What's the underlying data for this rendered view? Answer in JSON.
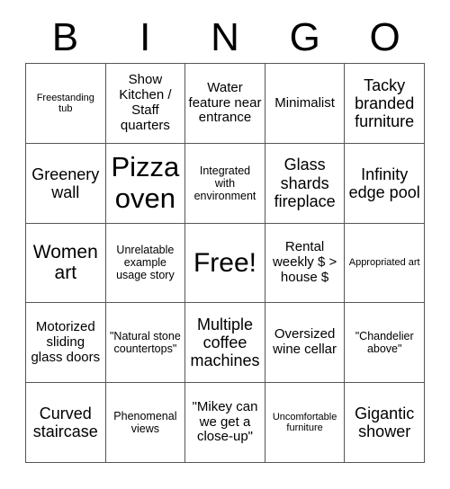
{
  "card": {
    "title": "BINGO",
    "header_letters": [
      "B",
      "I",
      "N",
      "G",
      "O"
    ],
    "grid": {
      "rows": 5,
      "columns": 5
    },
    "cells": [
      {
        "text": "Freestanding tub",
        "size": "xs"
      },
      {
        "text": "Show Kitchen / Staff quarters",
        "size": "m"
      },
      {
        "text": "Water feature near entrance",
        "size": "m"
      },
      {
        "text": "Minimalist",
        "size": "m"
      },
      {
        "text": "Tacky branded furniture",
        "size": "l"
      },
      {
        "text": "Greenery wall",
        "size": "l"
      },
      {
        "text": "Pizza oven",
        "size": "xxl"
      },
      {
        "text": "Integrated with environment",
        "size": "s"
      },
      {
        "text": "Glass shards fireplace",
        "size": "l"
      },
      {
        "text": "Infinity edge pool",
        "size": "l"
      },
      {
        "text": "Women art",
        "size": "xl"
      },
      {
        "text": "Unrelatable example usage story",
        "size": "s"
      },
      {
        "text": "Free!",
        "size": "free"
      },
      {
        "text": "Rental weekly $ > house $",
        "size": "m"
      },
      {
        "text": "Appropriated art",
        "size": "xs"
      },
      {
        "text": "Motorized sliding glass doors",
        "size": "m"
      },
      {
        "text": "\"Natural stone countertops\"",
        "size": "s"
      },
      {
        "text": "Multiple coffee machines",
        "size": "l"
      },
      {
        "text": "Oversized wine cellar",
        "size": "m"
      },
      {
        "text": "\"Chandelier above\"",
        "size": "s"
      },
      {
        "text": "Curved staircase",
        "size": "l"
      },
      {
        "text": "Phenomenal views",
        "size": "s"
      },
      {
        "text": "\"Mikey can we get a close-up\"",
        "size": "m"
      },
      {
        "text": "Uncomfortable furniture",
        "size": "xs"
      },
      {
        "text": "Gigantic shower",
        "size": "l"
      }
    ]
  },
  "colors": {
    "background": "#ffffff",
    "text": "#000000",
    "grid_line": "#555555"
  }
}
